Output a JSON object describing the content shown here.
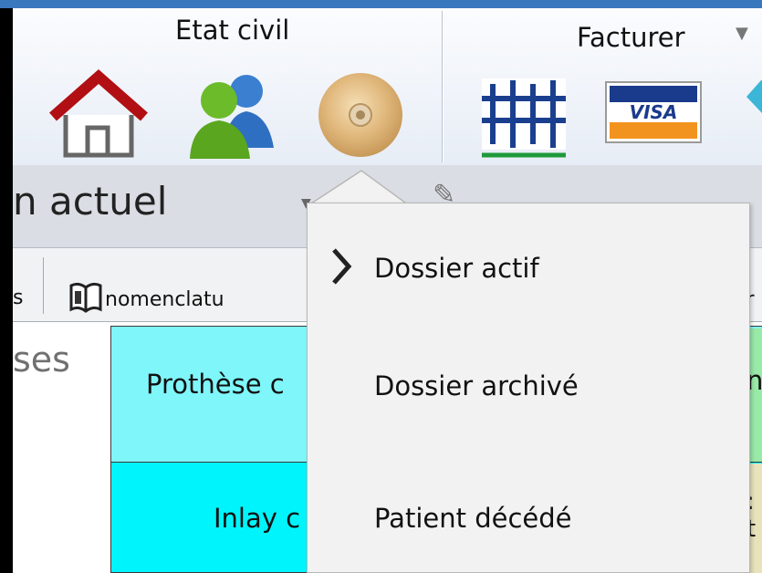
{
  "ribbon": {
    "groups": [
      {
        "label": "Etat civil",
        "icons": [
          "home-icon",
          "users-icon",
          "disc-icon"
        ]
      },
      {
        "label": "Facturer",
        "icons": [
          "insurance-icon",
          "visa-card-icon",
          "diamond-icon"
        ]
      }
    ],
    "visa_text": "VISA"
  },
  "toolbar": {
    "title_fragment": "n actuel"
  },
  "tabs": {
    "left_fragment": "s",
    "nomenclature": "nomenclatu",
    "right_fragment": "ér"
  },
  "content": {
    "left_fragment": "ses",
    "rows": [
      {
        "label": "Prothèse c",
        "color": "#7ff6fa"
      },
      {
        "label": "Inlay c",
        "color": "#00f4fb"
      }
    ],
    "right_col1": "n",
    "right_col2": ":\nt"
  },
  "menu": {
    "items": [
      {
        "label": "Dossier actif",
        "selected": true
      },
      {
        "label": "Dossier archivé",
        "selected": false
      },
      {
        "label": "Patient décédé",
        "selected": false
      }
    ]
  },
  "colors": {
    "accent": "#3a78be",
    "cyan_light": "#7ff6fa",
    "cyan": "#00f4fb",
    "green": "#99e9a8",
    "khaki": "#e9e3bc"
  }
}
